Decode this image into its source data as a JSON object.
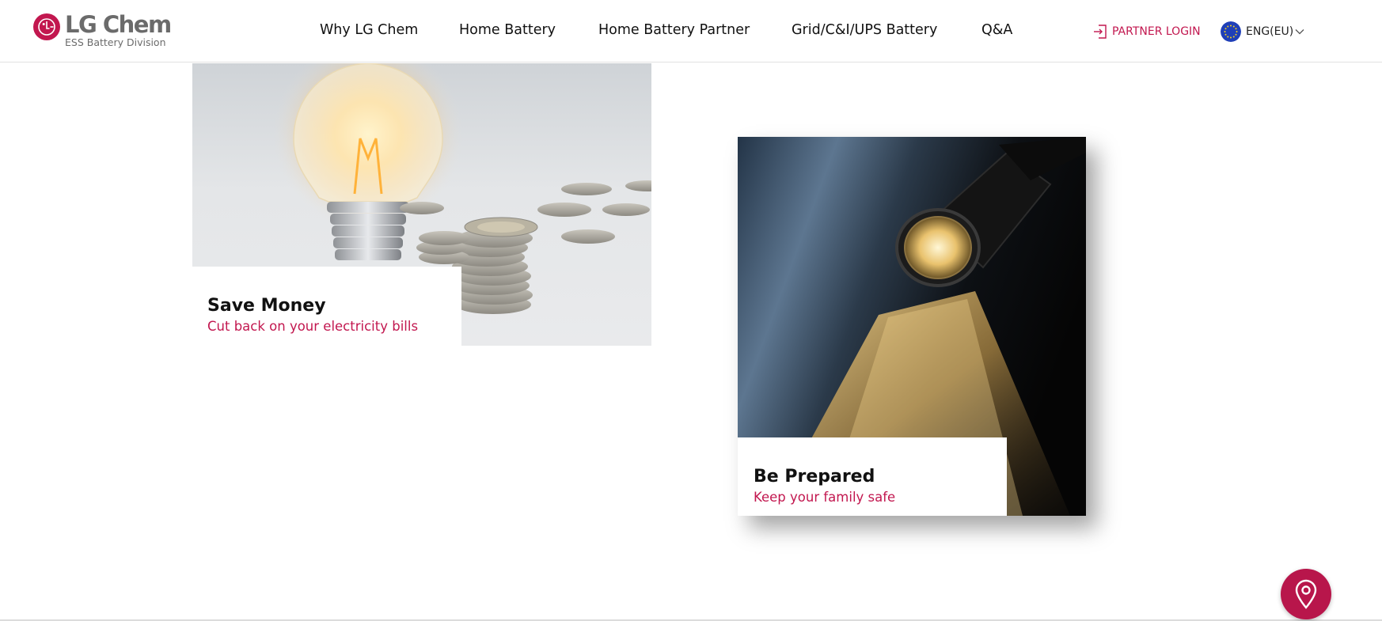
{
  "brand": {
    "name": "LG Chem",
    "division": "ESS Battery Division",
    "color": "#c2174f"
  },
  "nav": {
    "items": [
      {
        "label": "Why LG Chem"
      },
      {
        "label": "Home Battery"
      },
      {
        "label": "Home Battery Partner"
      },
      {
        "label": "Grid/C&I/UPS Battery"
      },
      {
        "label": "Q&A"
      }
    ]
  },
  "header": {
    "partner_login": "PARTNER LOGIN",
    "partner_login_icon": "login-icon",
    "language": "ENG(EU)",
    "language_icon": "eu-flag-icon"
  },
  "cards": [
    {
      "title": "Save Money",
      "subtitle": "Cut back on your electricity bills",
      "image": "light-bulb-and-coins"
    },
    {
      "title": "Be Prepared",
      "subtitle": "Keep your family safe",
      "image": "flashlight"
    }
  ],
  "floating": {
    "icon": "location-pin-icon",
    "color": "#b8164b"
  }
}
